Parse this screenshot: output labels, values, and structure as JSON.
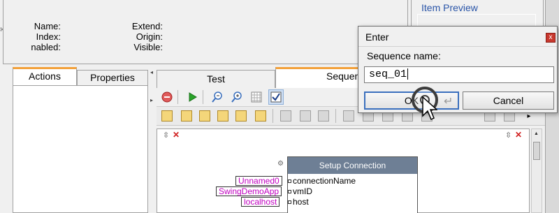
{
  "info": {
    "labels_left": [
      "Name:",
      "Index:",
      "nabled:"
    ],
    "labels_right": [
      "Extend:",
      "Origin:",
      "Visible:"
    ]
  },
  "preview": {
    "title": "Item Preview"
  },
  "left_tabs": [
    "Actions",
    "Properties"
  ],
  "center_tabs": [
    "Test",
    "Sequen"
  ],
  "toolbar1": {
    "icons": [
      "stop-record-icon",
      "play-icon",
      "zoom-out-icon",
      "zoom-in-icon",
      "grid-icon",
      "check-icon"
    ]
  },
  "node": {
    "title": "Setup Connection",
    "ports": [
      {
        "name": "connectionName",
        "value": "Unnamed0"
      },
      {
        "name": "vmID",
        "value": "SwingDemoApp"
      },
      {
        "name": "host",
        "value": "localhost"
      }
    ]
  },
  "dialog": {
    "title": "Enter",
    "close_label": "x",
    "prompt": "Sequence name:",
    "input_value": "seq_01",
    "ok_label": "OK",
    "cancel_label": "Cancel"
  },
  "colors": {
    "accent_tab": "#f3a13a",
    "node_header": "#6e7f95",
    "arg_text": "#c000c0",
    "preview_title": "#2a55a8"
  }
}
